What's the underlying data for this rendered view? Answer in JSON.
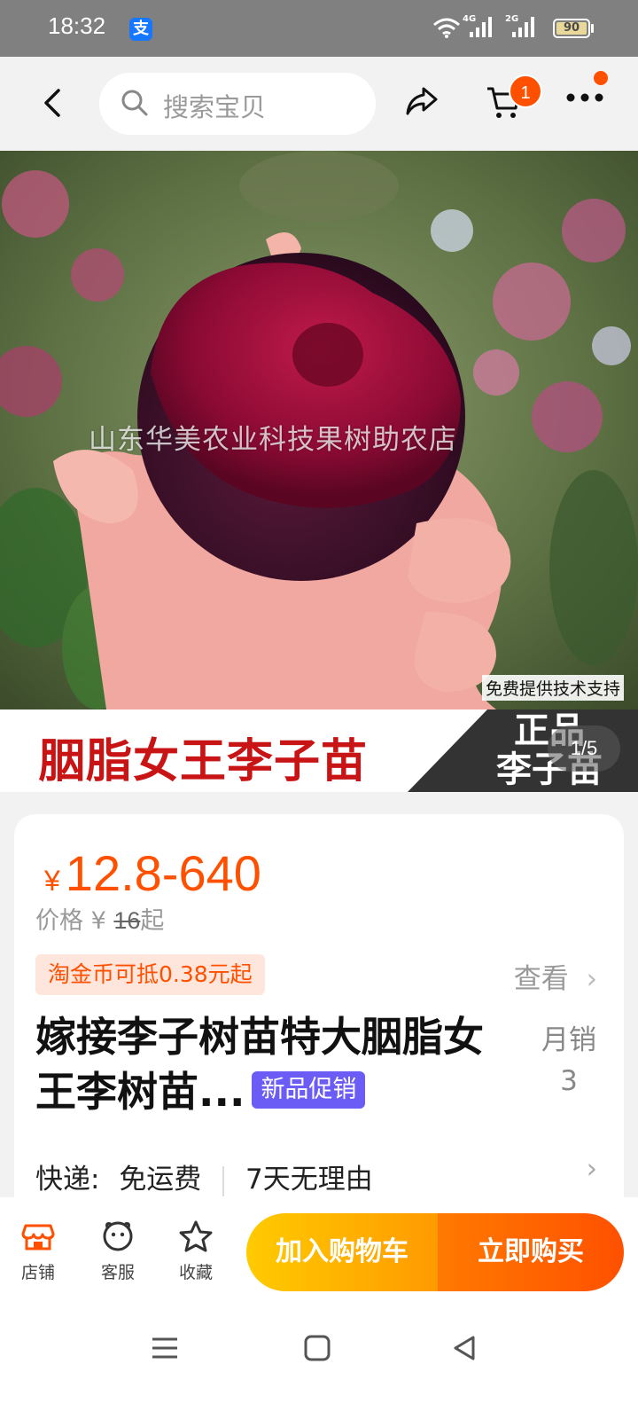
{
  "status_bar": {
    "time": "18:32",
    "app_icon": "alipay-icon",
    "net1": "4G",
    "net2": "2G",
    "battery_level": "90"
  },
  "nav": {
    "search_placeholder": "搜索宝贝",
    "cart_count": "1"
  },
  "hero": {
    "watermark": "山东华美农业科技果树助农店",
    "tech_support": "免费提供技术支持",
    "banner_title": "胭脂女王李子苗",
    "banner_right": "正品\n李子苗",
    "page_indicator": "1/5"
  },
  "product": {
    "price_symbol": "¥",
    "price": "12.8-640",
    "orig_label": "价格",
    "orig_symbol": "¥",
    "orig_price": "16",
    "orig_suffix": "起",
    "coin_tag": "淘金币可抵0.38元起",
    "view_link": "查看",
    "title": "嫁接李子树苗特大胭脂女王李树苗...",
    "promo_tag": "新品促销",
    "sales_label": "月销",
    "sales_count": "3",
    "shipping_label": "快递:",
    "shipping_value": "免运费",
    "return_policy": "7天无理由"
  },
  "actions": {
    "shop": "店铺",
    "service": "客服",
    "favorite": "收藏",
    "add_to_cart": "加入购物车",
    "buy_now": "立即购买"
  },
  "colors": {
    "accent": "#ff5000",
    "promo": "#6b5cf6",
    "cart_gradient_start": "#ffcb00",
    "buy_gradient_end": "#ff5000"
  }
}
